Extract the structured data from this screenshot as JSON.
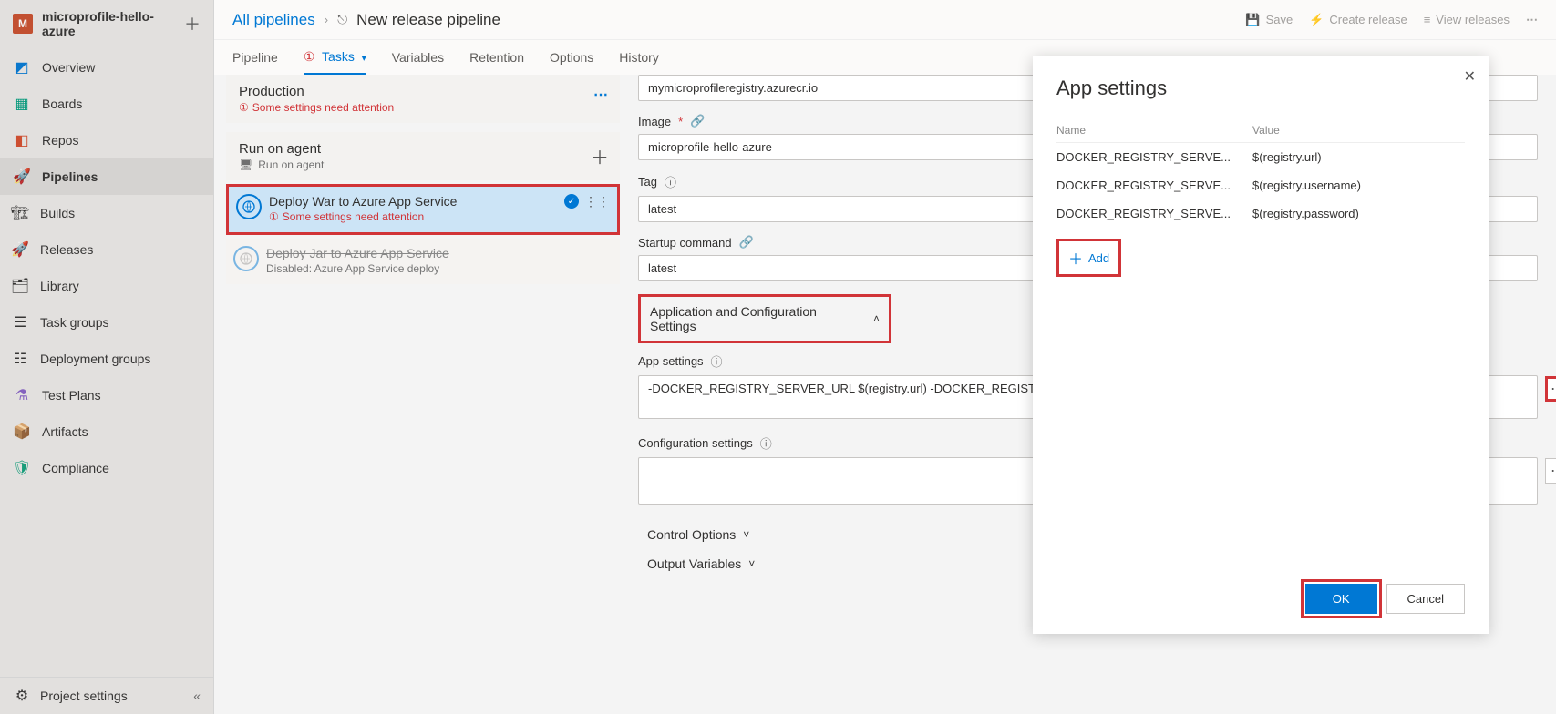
{
  "project": {
    "initial": "M",
    "name": "microprofile-hello-azure"
  },
  "sidebar": {
    "items": [
      {
        "label": "Overview",
        "color": "#0078d4"
      },
      {
        "label": "Boards",
        "color": "#009e7e"
      },
      {
        "label": "Repos",
        "color": "#d54c2c"
      },
      {
        "label": "Pipelines",
        "color": "#0078d4",
        "active": true
      },
      {
        "label": "Builds"
      },
      {
        "label": "Releases"
      },
      {
        "label": "Library"
      },
      {
        "label": "Task groups"
      },
      {
        "label": "Deployment groups"
      },
      {
        "label": "Test Plans",
        "color": "#8661c5"
      },
      {
        "label": "Artifacts",
        "color": "#c94e2c"
      },
      {
        "label": "Compliance",
        "color": "#0fa17b"
      }
    ],
    "settings": "Project settings"
  },
  "header": {
    "breadcrumb": "All pipelines",
    "title": "New release pipeline",
    "actions": {
      "save": "Save",
      "create": "Create release",
      "view": "View releases"
    }
  },
  "tabs": [
    {
      "label": "Pipeline"
    },
    {
      "label": "Tasks",
      "active": true,
      "warn": true
    },
    {
      "label": "Variables"
    },
    {
      "label": "Retention"
    },
    {
      "label": "Options"
    },
    {
      "label": "History"
    }
  ],
  "stage": {
    "title": "Production",
    "warn": "Some settings need attention",
    "agent": {
      "title": "Run on agent",
      "sub": "Run on agent"
    },
    "tasks": [
      {
        "title": "Deploy War to Azure App Service",
        "warn": "Some settings need attention",
        "selected": true
      },
      {
        "title": "Deploy Jar to Azure App Service",
        "sub": "Disabled: Azure App Service deploy",
        "disabled": true
      }
    ]
  },
  "details": {
    "registry_value": "mymicroprofileregistry.azurecr.io",
    "image_label": "Image",
    "image_value": "microprofile-hello-azure",
    "tag_label": "Tag",
    "tag_value": "latest",
    "startup_label": "Startup command",
    "startup_value": "latest",
    "section_appconfig": "Application and Configuration Settings",
    "appsettings_label": "App settings",
    "appsettings_value": "-DOCKER_REGISTRY_SERVER_URL $(registry.url) -DOCKER_REGISTRY_SERVER_PASSWORD $(registr",
    "configsettings_label": "Configuration settings",
    "section_control": "Control Options",
    "section_output": "Output Variables"
  },
  "modal": {
    "title": "App settings",
    "col_name": "Name",
    "col_value": "Value",
    "rows": [
      {
        "name": "DOCKER_REGISTRY_SERVE...",
        "value": "$(registry.url)"
      },
      {
        "name": "DOCKER_REGISTRY_SERVE...",
        "value": "$(registry.username)"
      },
      {
        "name": "DOCKER_REGISTRY_SERVE...",
        "value": "$(registry.password)"
      }
    ],
    "add": "Add",
    "ok": "OK",
    "cancel": "Cancel"
  }
}
